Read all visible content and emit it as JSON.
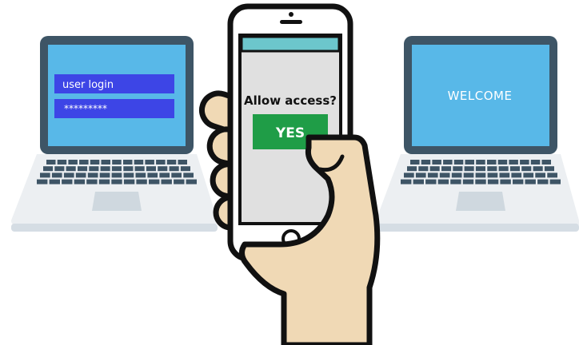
{
  "left_laptop": {
    "username_text": "user login",
    "password_text": "*********"
  },
  "phone": {
    "prompt": "Allow access?",
    "confirm_label": "YES"
  },
  "right_laptop": {
    "screen_text": "WELCOME"
  },
  "colors": {
    "laptop_frame": "#3e5566",
    "laptop_screen": "#58b8e8",
    "login_field": "#3d45e6",
    "keyboard_base": "#eceff2",
    "base_shadow": "#d5dde4",
    "phone_screen": "#e0e0e0",
    "phone_topbar": "#6cc6cc",
    "yes_button": "#1f9d47",
    "hand_skin": "#f0d9b5",
    "outline": "#111111"
  }
}
